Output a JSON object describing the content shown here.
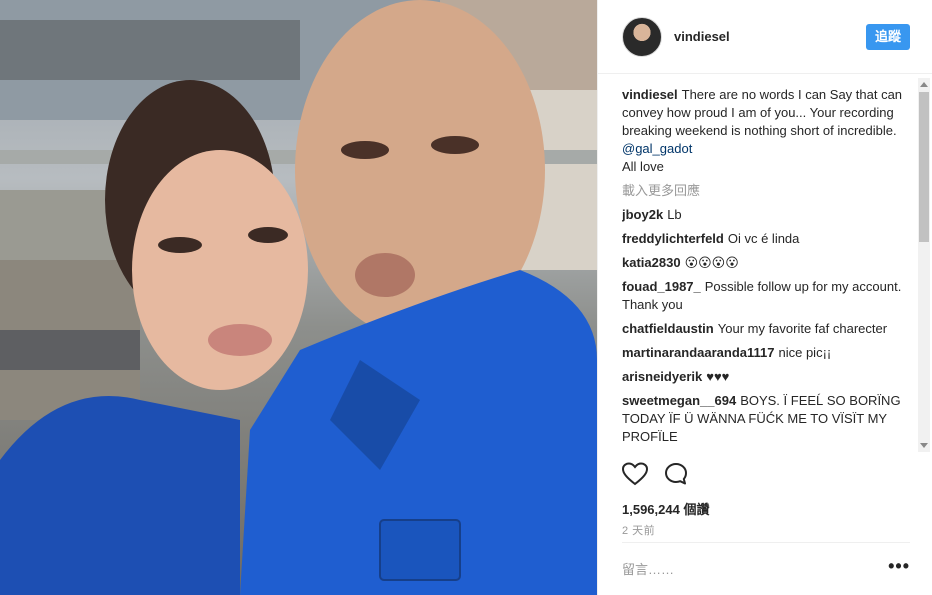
{
  "header": {
    "username": "vindiesel",
    "follow_label": "追蹤"
  },
  "caption": {
    "username": "vindiesel",
    "text": "There are no words I can Say that can convey how proud I am of you... Your recording breaking weekend is nothing short of incredible.",
    "mention": "@gal_gadot",
    "text_end": "All love"
  },
  "load_more_label": "載入更多回應",
  "comments": [
    {
      "user": "jboy2k",
      "text": "Lb"
    },
    {
      "user": "freddylichterfeld",
      "text": "Oi vc é linda"
    },
    {
      "user": "katia2830",
      "text": "😮😮😮😮"
    },
    {
      "user": "fouad_1987_",
      "text": "Possible follow up for my account. Thank you"
    },
    {
      "user": "chatfieldaustin",
      "text": "Your my favorite faf charecter"
    },
    {
      "user": "martinarandaaranda1117",
      "text": "nice pic¡¡"
    },
    {
      "user": "arisneidyerik",
      "text": "♥♥♥"
    },
    {
      "user": "sweetmegan__694",
      "text": "BOYS. Ï FEEĹ SO BORÏNG TODAY ÏF Ü WÄNNA FÜĆK ME TO VÏSÏT MY PROFÏLE"
    }
  ],
  "actions": {
    "like_icon": "heart-outline",
    "comment_icon": "speech-bubble"
  },
  "likes": {
    "count": "1,596,244",
    "unit": "個讚"
  },
  "time_ago": "2 天前",
  "comment_box": {
    "placeholder": "留言……",
    "more_label": "•••"
  },
  "colors": {
    "accent": "#3897f0",
    "mention": "#003569",
    "muted": "#999999"
  }
}
